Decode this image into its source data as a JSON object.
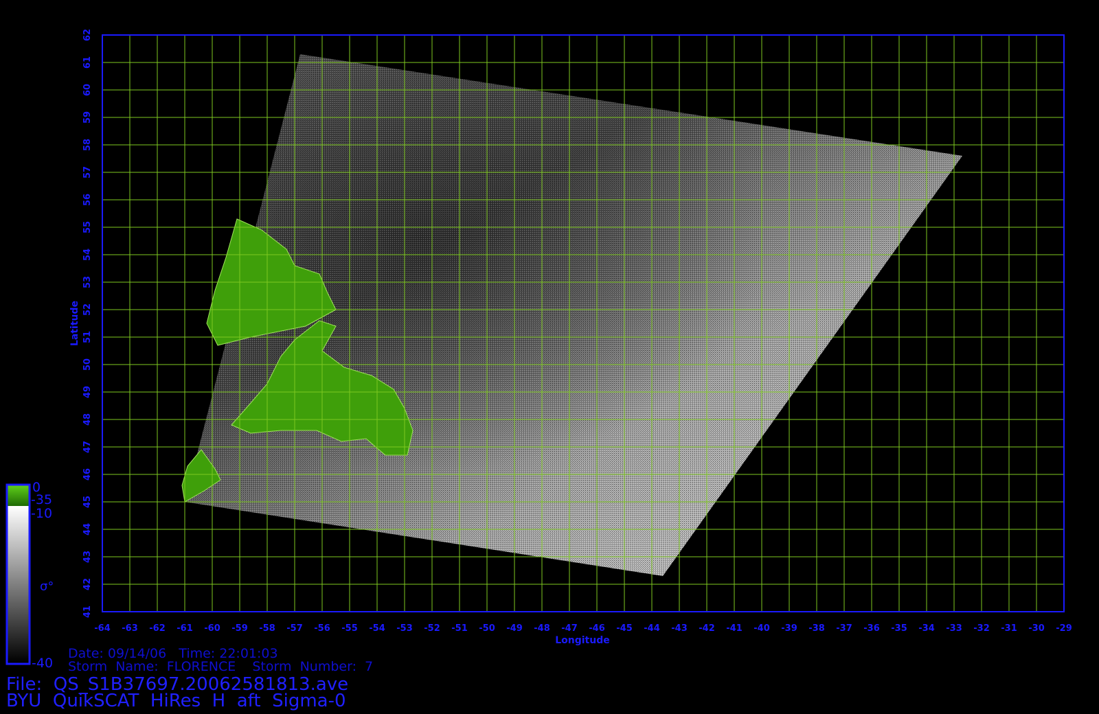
{
  "axes": {
    "x_label": "Longitude",
    "y_label": "Latitude",
    "lon_range": [
      -64,
      -29
    ],
    "lat_range": [
      41,
      62
    ],
    "lon_ticks": [
      -64,
      -63,
      -62,
      -61,
      -60,
      -59,
      -58,
      -57,
      -56,
      -55,
      -54,
      -53,
      -52,
      -51,
      -50,
      -49,
      -48,
      -47,
      -46,
      -45,
      -44,
      -43,
      -42,
      -41,
      -40,
      -39,
      -38,
      -37,
      -36,
      -35,
      -34,
      -33,
      -32,
      -31,
      -30,
      -29
    ],
    "lat_ticks": [
      41,
      42,
      43,
      44,
      45,
      46,
      47,
      48,
      49,
      50,
      51,
      52,
      53,
      54,
      55,
      56,
      57,
      58,
      59,
      60,
      61,
      62
    ],
    "grid": true
  },
  "colorbar": {
    "top_label": "0",
    "land_bottom_label": "-35",
    "gray_top_label": "-10",
    "bottom_label": "-40",
    "symbol": "σ°"
  },
  "info": {
    "date_line": "Date: 09/14/06   Time: 22:01:03",
    "storm_line": "Storm  Name:  FLORENCE    Storm  Number:  7",
    "file_line": "File:  QS_S1B37697.20062581813.ave",
    "product_line": "BYU  QuikSCAT  HiRes  H  aft  Sigma-0"
  },
  "colors": {
    "frame": "#1a1aff",
    "grid": "#7ec820",
    "land": "#3f9f0a",
    "text": "#1a1aff"
  },
  "swath": {
    "corners_lonlat": [
      [
        -56.8,
        61.3
      ],
      [
        -32.7,
        57.6
      ],
      [
        -43.6,
        42.3
      ],
      [
        -61.0,
        45.0
      ]
    ]
  },
  "land_masses": [
    {
      "name": "labrador",
      "outline_lonlat": [
        [
          -59.1,
          55.3
        ],
        [
          -58.2,
          54.9
        ],
        [
          -57.3,
          54.2
        ],
        [
          -57.0,
          53.6
        ],
        [
          -56.1,
          53.3
        ],
        [
          -55.8,
          52.6
        ],
        [
          -55.5,
          52.0
        ],
        [
          -56.6,
          51.4
        ],
        [
          -57.6,
          51.2
        ],
        [
          -58.6,
          51.0
        ],
        [
          -59.8,
          50.7
        ],
        [
          -60.2,
          51.5
        ],
        [
          -59.9,
          52.7
        ],
        [
          -59.5,
          53.9
        ]
      ]
    },
    {
      "name": "newfoundland",
      "outline_lonlat": [
        [
          -59.3,
          47.8
        ],
        [
          -58.6,
          48.6
        ],
        [
          -58.0,
          49.3
        ],
        [
          -57.5,
          50.3
        ],
        [
          -57.0,
          50.9
        ],
        [
          -56.1,
          51.6
        ],
        [
          -55.5,
          51.4
        ],
        [
          -56.0,
          50.5
        ],
        [
          -55.2,
          49.9
        ],
        [
          -54.2,
          49.6
        ],
        [
          -53.4,
          49.1
        ],
        [
          -53.0,
          48.4
        ],
        [
          -52.7,
          47.6
        ],
        [
          -52.9,
          46.7
        ],
        [
          -53.7,
          46.7
        ],
        [
          -54.4,
          47.3
        ],
        [
          -55.3,
          47.2
        ],
        [
          -56.2,
          47.6
        ],
        [
          -57.5,
          47.6
        ],
        [
          -58.6,
          47.5
        ]
      ]
    },
    {
      "name": "cape-breton",
      "outline_lonlat": [
        [
          -61.0,
          45.0
        ],
        [
          -61.1,
          45.6
        ],
        [
          -60.9,
          46.3
        ],
        [
          -60.4,
          46.9
        ],
        [
          -59.9,
          46.2
        ],
        [
          -59.7,
          45.8
        ],
        [
          -60.3,
          45.4
        ]
      ]
    }
  ]
}
